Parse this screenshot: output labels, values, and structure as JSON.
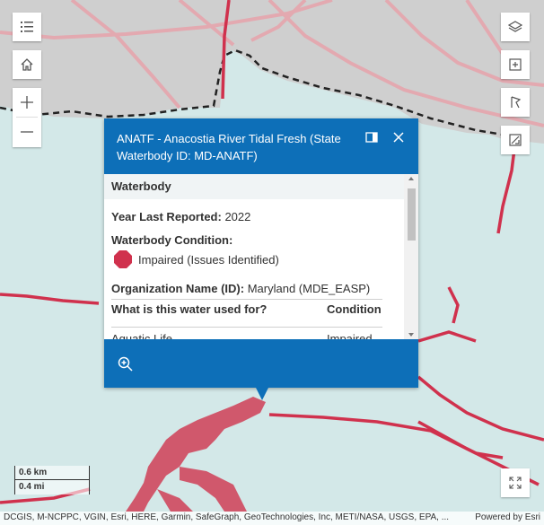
{
  "map": {
    "land_color": "#cfcfcf",
    "water_color": "#d3e8e8",
    "impaired_color": "#d0314d"
  },
  "controls": {
    "legend_icon": "list-icon",
    "home_icon": "home-icon",
    "zoom_in_icon": "plus-icon",
    "zoom_out_icon": "minus-icon",
    "layers_icon": "layers-icon",
    "add_layer_icon": "plus-square-icon",
    "basemap_icon": "flag-icon",
    "sketch_icon": "sketch-icon",
    "fullscreen_icon": "expand-icon"
  },
  "popup": {
    "title": "ANATF - Anacostia River Tidal Fresh (State Waterbody ID: MD-ANATF)",
    "header_color": "#0d6fb8",
    "dock_icon": "dock-icon",
    "close_icon": "close-icon",
    "section_title": "Waterbody",
    "year_label": "Year Last Reported:",
    "year_value": "2022",
    "condition_label": "Waterbody Condition:",
    "condition_value": "Impaired (Issues Identified)",
    "org_label": "Organization Name (ID):",
    "org_value": "Maryland (MDE_EASP)",
    "table": {
      "col_use": "What is this water used for?",
      "col_condition": "Condition",
      "first_row_use": "Aquatic Life",
      "first_row_condition": "Impaired"
    },
    "zoom_to_icon": "zoom-in-icon"
  },
  "scale": {
    "metric": "0.6 km",
    "imperial": "0.4 mi"
  },
  "attribution": {
    "sources": "DCGIS, M-NCPPC, VGIN, Esri, HERE, Garmin, SafeGraph, GeoTechnologies, Inc, METI/NASA, USGS, EPA, ...",
    "powered_by": "Powered by Esri"
  }
}
